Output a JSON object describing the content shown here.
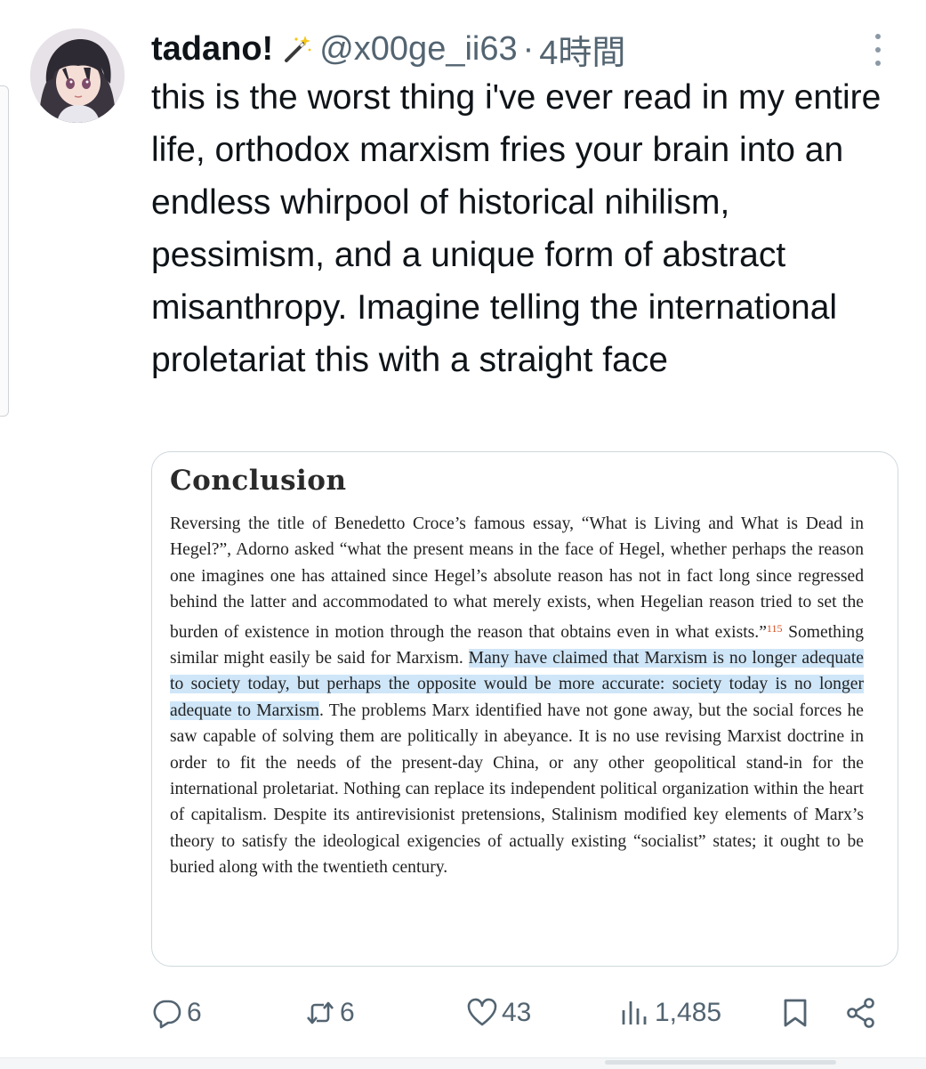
{
  "post": {
    "display_name": "tadano!",
    "name_emoji": "magic-wand-icon",
    "handle": "@x00ge_ii63",
    "separator": "·",
    "time": "4時間",
    "text": "this is the worst thing i've ever read in my entire life, orthodox marxism fries your brain into an endless whirpool of historical nihilism, pessimism, and a unique form of abstract misanthropy. Imagine telling the international proletariat this with a straight face"
  },
  "attachment": {
    "title": "Conclusion",
    "para_before": "Reversing the title of Benedetto Croce’s famous essay, “What is Living and What is Dead in Hegel?”, Adorno asked “what the present means in the face of Hegel, whether perhaps the reason one imagines one has attained since Hegel’s absolute reason has not in fact long since regressed behind the latter and accommodated to what merely exists, when Hegelian reason tried to set the burden of existence in motion through the reason that obtains even in what exists.”",
    "footnote": "115",
    "para_middle": " Something similar might easily be said for Marxism. ",
    "highlighted": "Many have claimed that Marxism is no longer adequate to society today, but perhaps the opposite would be more accurate: society today is no longer adequate to Marxism",
    "para_after": ". The problems Marx identified have not gone away, but the social forces he saw capable of solving them are politically in abeyance. It is no use revising Marxist doctrine in order to fit the needs of the present-day China, or any other geopolitical stand-in for the international proletariat. Nothing can replace its independent political organization within the heart of capitalism. Despite its antirevisionist pretensions, Stalinism modified key elements of Marx’s theory to satisfy the ideological exigencies of actually existing “socialist” states; it ought to be buried along with the twentieth century."
  },
  "actions": {
    "replies": "6",
    "reposts": "6",
    "likes": "43",
    "views": "1,485"
  },
  "colors": {
    "text": "#0f1419",
    "muted": "#536471",
    "highlight": "#cfe6f8",
    "footnote": "#d84c1d",
    "border": "#cfd9de"
  }
}
